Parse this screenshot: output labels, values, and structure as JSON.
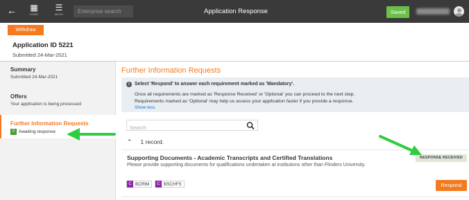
{
  "colors": {
    "accent": "#f47a20",
    "topbar": "#3a3a3a",
    "saved": "#6cc04a",
    "status_green": "#4a9a3a",
    "badge_bg": "#dfe8d5",
    "tag_purple": "#8e24aa",
    "annotation_arrow": "#2ecc40"
  },
  "topbar": {
    "back_icon": "arrow-left-icon",
    "home_icon": "grid-icon",
    "home_caption": "HOME",
    "menu_icon": "hamburger-icon",
    "menu_caption": "MENU",
    "search_placeholder": "Enterprise search",
    "title": "Application Response",
    "saved_label": "Saved",
    "avatar_icon": "user-avatar-icon"
  },
  "header": {
    "withdraw_label": "Withdraw",
    "application_id": "Application ID 5221",
    "submitted": "Submitted 24-Mar-2021"
  },
  "sidebar": {
    "items": [
      {
        "label": "Summary",
        "sub": "Submitted 24-Mar-2021"
      },
      {
        "label": "Offers",
        "sub": "Your application is being processed"
      },
      {
        "label": "Further Information Requests",
        "status_count": "0",
        "status_text": "Awaiting response"
      }
    ]
  },
  "main": {
    "title": "Further Information Requests",
    "info": {
      "icon": "info-icon",
      "heading": "Select 'Respond' to answer each requirement marked as 'Mandatory'.",
      "line1": "Once all requirements are marked as 'Response Received' or 'Optional' you can proceed to the next step.",
      "line2": "Requirements marked as 'Optional' may help us assess your application faster if you provide a response.",
      "show_less": "Show less"
    },
    "search_placeholder": "Search",
    "search_icon": "magnifier-icon",
    "records_chevron": "chevron-up-icon",
    "records_text": "1 record.",
    "request": {
      "title": "Supporting Documents - Academic Transcripts and Certified Translations",
      "description": "Please provide supporting documents for qualifications undertaken at institutions other than Flinders University.",
      "badge": "RESPONSE RECEIVED",
      "tags": [
        {
          "letter": "C",
          "code": "BCRIM"
        },
        {
          "letter": "C",
          "code": "BSCHFS"
        }
      ],
      "respond_label": "Respond"
    }
  }
}
